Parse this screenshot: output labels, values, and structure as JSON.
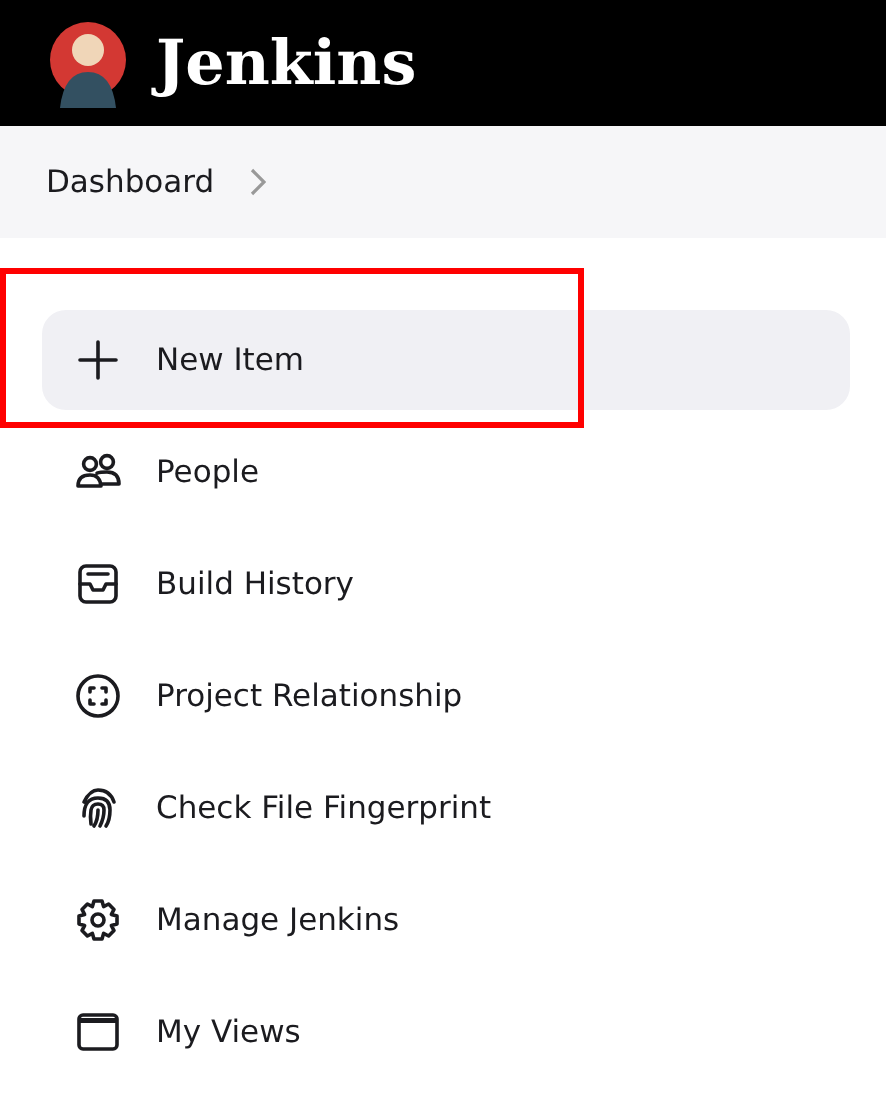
{
  "header": {
    "title": "Jenkins"
  },
  "breadcrumb": {
    "items": [
      "Dashboard"
    ]
  },
  "sidebar": {
    "items": [
      {
        "label": "New Item",
        "hovered": true,
        "annotated": true
      },
      {
        "label": "People",
        "hovered": false,
        "annotated": false
      },
      {
        "label": "Build History",
        "hovered": false,
        "annotated": false
      },
      {
        "label": "Project Relationship",
        "hovered": false,
        "annotated": false
      },
      {
        "label": "Check File Fingerprint",
        "hovered": false,
        "annotated": false
      },
      {
        "label": "Manage Jenkins",
        "hovered": false,
        "annotated": false
      },
      {
        "label": "My Views",
        "hovered": false,
        "annotated": false
      }
    ]
  }
}
